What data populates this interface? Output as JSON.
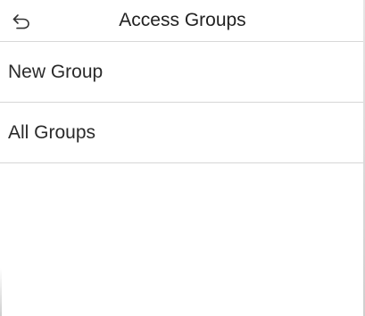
{
  "header": {
    "back_icon": "back-arrow-icon",
    "title": "Access Groups"
  },
  "menu": {
    "items": [
      {
        "label": "New Group"
      },
      {
        "label": "All Groups"
      }
    ]
  },
  "colors": {
    "background": "#ffffff",
    "text": "#222222",
    "divider": "#d6d6d6"
  }
}
